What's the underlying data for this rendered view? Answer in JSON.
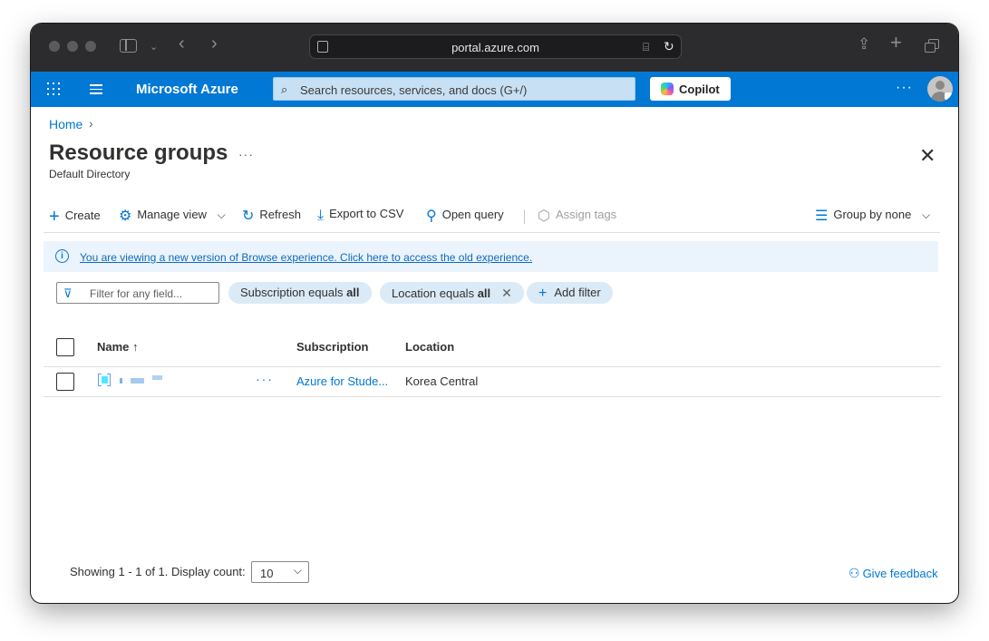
{
  "browser": {
    "url": "portal.azure.com",
    "icons": [
      "sidebar-icon",
      "chevron-down-icon",
      "back-icon",
      "forward-icon",
      "page-icon",
      "translate-icon",
      "reload-icon",
      "share-icon",
      "new-tab-icon",
      "tabs-overview-icon"
    ]
  },
  "header": {
    "brand": "Microsoft Azure",
    "search_placeholder": "Search resources, services, and docs (G+/)",
    "copilot_label": "Copilot",
    "more_label": "···",
    "accent": "#0078d4"
  },
  "breadcrumb": {
    "home": "Home",
    "chevron": "›"
  },
  "page": {
    "title": "Resource groups",
    "more": "···",
    "subtitle": "Default Directory",
    "close": "✕"
  },
  "toolbar": {
    "create": "Create",
    "manage_view": "Manage view",
    "refresh": "Refresh",
    "export": "Export to CSV",
    "open_query": "Open query",
    "assign_tags": "Assign tags",
    "group_by": "Group by none"
  },
  "info_banner": {
    "text": "You are viewing a new version of Browse experience. Click here to access the old experience."
  },
  "filters": {
    "placeholder": "Filter for any field...",
    "subscription_prefix": "Subscription equals ",
    "subscription_value": "all",
    "location_prefix": "Location equals ",
    "location_value": "all",
    "add_filter": "Add filter"
  },
  "table": {
    "columns": {
      "name": "Name ↑",
      "subscription": "Subscription",
      "location": "Location"
    },
    "rows": [
      {
        "name": "",
        "more": "···",
        "subscription": "Azure for Stude...",
        "location": "Korea Central"
      }
    ]
  },
  "footer": {
    "showing": "Showing 1 - 1 of 1. Display count:",
    "display_count": "10",
    "feedback": "Give feedback"
  }
}
